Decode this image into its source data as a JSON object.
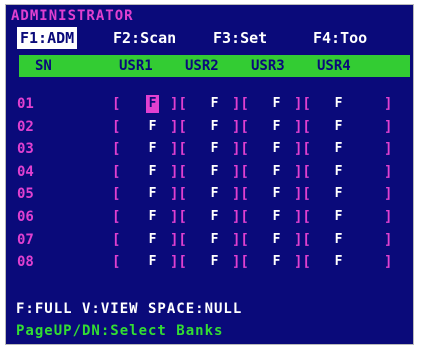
{
  "title": "ADMINISTRATOR",
  "menu": {
    "items": [
      "F1:ADM",
      "F2:Scan",
      "F3:Set",
      "F4:Too"
    ],
    "active_index": 0
  },
  "table": {
    "headers": [
      "SN",
      "USR1",
      "USR2",
      "USR3",
      "USR4"
    ],
    "rows": [
      {
        "sn": "01",
        "perms": [
          "F",
          "F",
          "F",
          "F"
        ]
      },
      {
        "sn": "02",
        "perms": [
          "F",
          "F",
          "F",
          "F"
        ]
      },
      {
        "sn": "03",
        "perms": [
          "F",
          "F",
          "F",
          "F"
        ]
      },
      {
        "sn": "04",
        "perms": [
          "F",
          "F",
          "F",
          "F"
        ]
      },
      {
        "sn": "05",
        "perms": [
          "F",
          "F",
          "F",
          "F"
        ]
      },
      {
        "sn": "06",
        "perms": [
          "F",
          "F",
          "F",
          "F"
        ]
      },
      {
        "sn": "07",
        "perms": [
          "F",
          "F",
          "F",
          "F"
        ]
      },
      {
        "sn": "08",
        "perms": [
          "F",
          "F",
          "F",
          "F"
        ]
      }
    ],
    "selected_cell": {
      "row": 0,
      "col": 0
    }
  },
  "legend": {
    "line1": "F:FULL V:VIEW SPACE:NULL",
    "line2": "PageUP/DN:Select Banks"
  },
  "colors": {
    "background": "#0a0a7a",
    "accent_magenta": "#e040d0",
    "header_green": "#33cc33",
    "text_white": "#ffffff"
  }
}
